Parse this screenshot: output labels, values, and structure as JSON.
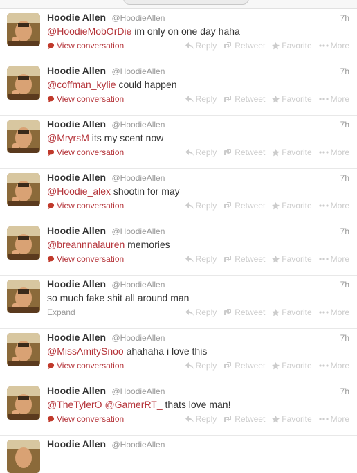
{
  "profile": {
    "name": "Hoodie Allen",
    "handle": "@HoodieAllen"
  },
  "actions": {
    "reply": "Reply",
    "retweet": "Retweet",
    "favorite": "Favorite",
    "more": "More"
  },
  "tweets": [
    {
      "time": "7h",
      "mention": "@HoodieMobOrDie",
      "text": " im only on one day haha",
      "link": "View conversation"
    },
    {
      "time": "7h",
      "mention": "@coffman_kylie",
      "text": " could happen",
      "link": "View conversation"
    },
    {
      "time": "7h",
      "mention": "@MryrsM",
      "text": " its my scent now",
      "link": "View conversation"
    },
    {
      "time": "7h",
      "mention": "@Hoodie_alex",
      "text": " shootin for may",
      "link": "View conversation"
    },
    {
      "time": "7h",
      "mention": "@breannnalauren",
      "text": " memories",
      "link": "View conversation"
    },
    {
      "time": "7h",
      "mention": "",
      "text": "so much fake shit all around man",
      "link": "Expand"
    },
    {
      "time": "7h",
      "mention": "@MissAmitySnoo",
      "text": " ahahaha i love this",
      "link": "View conversation"
    },
    {
      "time": "7h",
      "mention": "@TheTylerO @GamerRT_",
      "text": " thats love man!",
      "link": "View conversation"
    },
    {
      "time": "",
      "mention": "",
      "text": "",
      "link": ""
    }
  ]
}
